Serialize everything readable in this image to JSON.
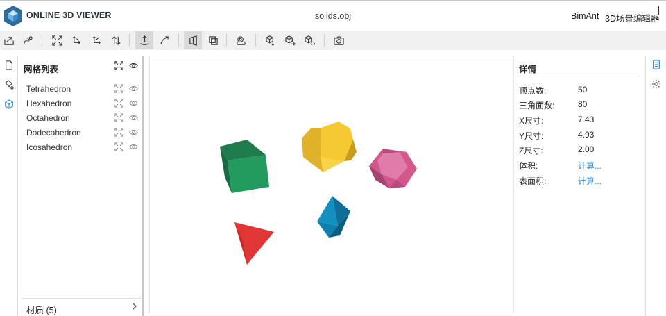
{
  "header": {
    "app_title": "ONLINE 3D VIEWER",
    "file_name": "solids.obj",
    "links": [
      "BimAnt",
      "3D场景编辑器"
    ]
  },
  "toolbar": {
    "buttons": [
      {
        "name": "open-file",
        "icon": "open-file-icon"
      },
      {
        "name": "open-url",
        "icon": "open-url-icon"
      },
      {
        "name": "fit-to-window",
        "icon": "fit-icon"
      },
      {
        "name": "set-up-vector",
        "icon": "up-vector-icon"
      },
      {
        "name": "flip-up-vector",
        "icon": "flip-icon"
      },
      {
        "name": "flip-up-down",
        "icon": "arrows-updown-icon"
      },
      {
        "name": "fixed-up-vector",
        "icon": "fixed-up-icon",
        "selected": true
      },
      {
        "name": "free-orbit",
        "icon": "free-orbit-icon"
      },
      {
        "name": "perspective-camera",
        "icon": "perspective-icon",
        "selected": true
      },
      {
        "name": "orthographic-camera",
        "icon": "orthographic-icon"
      },
      {
        "name": "measure",
        "icon": "measure-icon"
      },
      {
        "name": "export-model",
        "icon": "export-icon"
      },
      {
        "name": "share-model",
        "icon": "share-icon"
      },
      {
        "name": "embed-model",
        "icon": "embed-icon"
      },
      {
        "name": "snapshot",
        "icon": "camera-icon"
      }
    ]
  },
  "mesh_panel": {
    "title": "网格列表",
    "items": [
      "Tetrahedron",
      "Hexahedron",
      "Octahedron",
      "Dodecahedron",
      "Icosahedron"
    ],
    "materials_label": "材质 (5)"
  },
  "details": {
    "title": "详情",
    "rows": [
      {
        "key": "顶点数:",
        "value": "50"
      },
      {
        "key": "三角面数:",
        "value": "80"
      },
      {
        "key": "X尺寸:",
        "value": "7.43"
      },
      {
        "key": "Y尺寸:",
        "value": "4.93"
      },
      {
        "key": "Z尺寸:",
        "value": "2.00"
      },
      {
        "key": "体积:",
        "value": "计算..."
      },
      {
        "key": "表面积:",
        "value": "计算..."
      }
    ]
  },
  "colors": {
    "hexahedron": "#239a5e",
    "dodecahedron": "#f6c832",
    "icosahedron": "#d2588c",
    "octahedron": "#138fc0",
    "tetrahedron": "#e03636",
    "link": "#2c8cc4"
  }
}
